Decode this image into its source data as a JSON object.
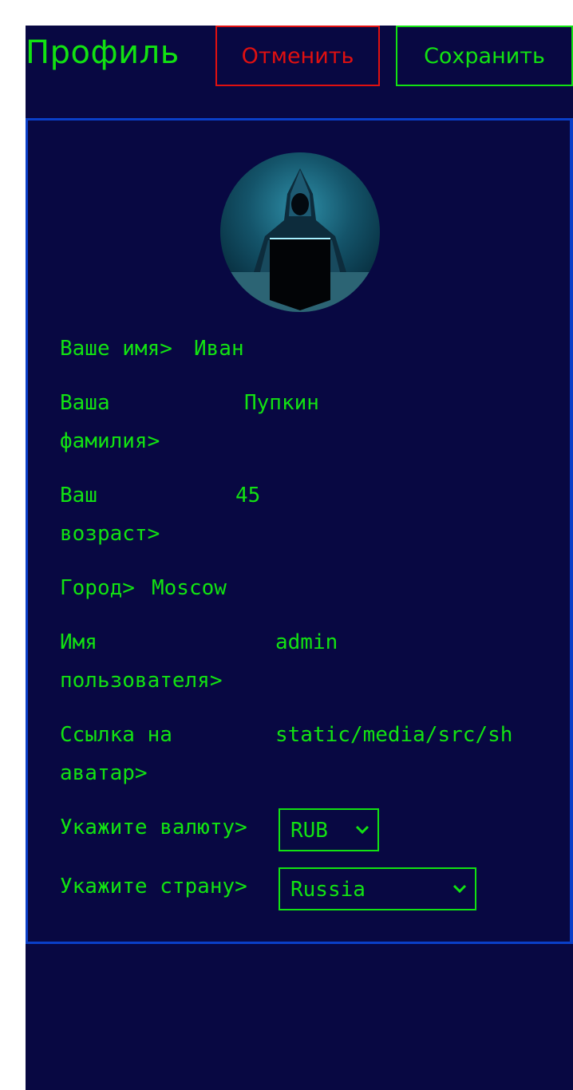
{
  "header": {
    "title": "Профиль",
    "cancel_label": "Отменить",
    "save_label": "Сохранить"
  },
  "profile": {
    "avatar_icon": "hooded-hacker-avatar",
    "fields": [
      {
        "label": "Ваше имя>",
        "value": "Иван"
      },
      {
        "label": "Ваша\nфамилия>",
        "value": "Пупкин"
      },
      {
        "label": "Ваш\nвозраст>",
        "value": "45"
      },
      {
        "label": "Город>",
        "value": "Moscow"
      },
      {
        "label": "Имя\nпользователя>",
        "value": "admin"
      },
      {
        "label": "Ссылка на\nаватар>",
        "value": "static/media/src/sh"
      }
    ],
    "currency": {
      "label": "Укажите валюту>",
      "selected": "RUB"
    },
    "country": {
      "label": "Укажите страну>",
      "selected": "Russia"
    }
  },
  "colors": {
    "background": "#080842",
    "accent": "#12e212",
    "danger": "#e01010",
    "card_border": "#0a3fc8"
  }
}
